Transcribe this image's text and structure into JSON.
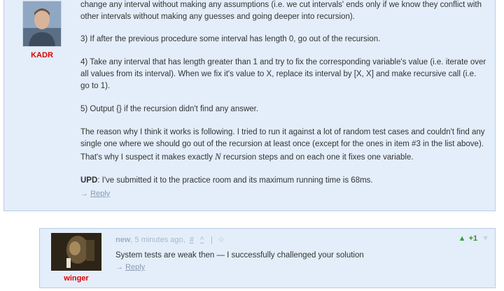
{
  "post": {
    "username": "KADR",
    "paragraphs": {
      "p1": "change any interval without making any assumptions (i.e. we cut intervals' ends only if we know they conflict with other intervals without making any guesses and going deeper into recursion).",
      "p2": "3) If after the previous procedure some interval has length 0, go out of the recursion.",
      "p3": "4) Take any interval that has length greater than 1 and try to fix the corresponding variable's value (i.e. iterate over all values from its interval). When we fix it's value to X, replace its interval by [X, X] and make recursive call (i.e. go to 1).",
      "p4": "5) Output {} if the recursion didn't find any answer.",
      "p5a": "The reason why I think it works is following. I tried to run it against a lot of random test cases and couldn't find any single one where we should go out of the recursion at least once (except for the ones in item #3 in the list above). That's why I suspect it makes exactly ",
      "p5math": "N",
      "p5b": " recursion steps and on each one it fixes one variable.",
      "upd_label": "UPD",
      "upd_text": ": I've submitted it to the practice room and its maximum running time is 68ms."
    },
    "reply": {
      "arrow": "→",
      "label": "Reply"
    }
  },
  "comment": {
    "username": "winger",
    "author": "new",
    "time": "5 minutes ago,",
    "icons": [
      "#",
      "^",
      "|",
      "☆"
    ],
    "text": "System tests are weak then — I successfully challenged your solution",
    "reply": {
      "arrow": "→",
      "label": "Reply"
    },
    "vote": {
      "count": "+1"
    }
  }
}
